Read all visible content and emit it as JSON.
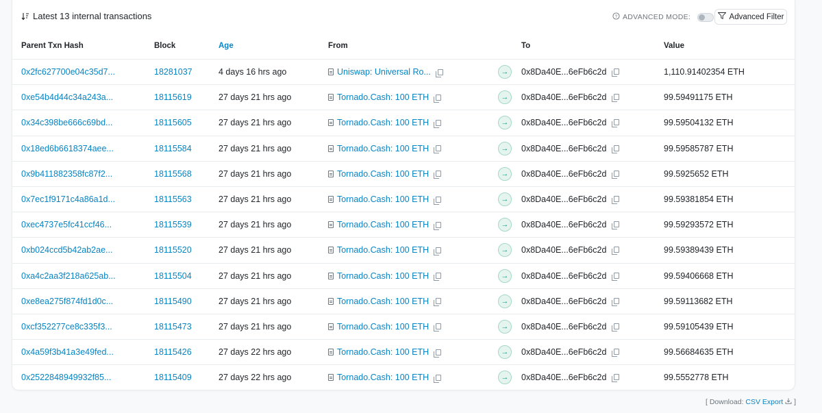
{
  "header": {
    "title": "Latest 13 internal transactions",
    "advanced_mode_label": "ADVANCED MODE:",
    "advanced_filter_label": "Advanced Filter"
  },
  "columns": {
    "parent_txn_hash": "Parent Txn Hash",
    "block": "Block",
    "age": "Age",
    "from": "From",
    "to": "To",
    "value": "Value"
  },
  "rows": [
    {
      "hash": "0x2fc627700e04c35d7...",
      "block": "18281037",
      "age": "4 days 16 hrs ago",
      "from": "Uniswap: Universal Ro...",
      "to": "0x8Da40E...6eFb6c2d",
      "value": "1,110.91402354 ETH"
    },
    {
      "hash": "0xe54b4d44c34a243a...",
      "block": "18115619",
      "age": "27 days 21 hrs ago",
      "from": "Tornado.Cash: 100 ETH",
      "to": "0x8Da40E...6eFb6c2d",
      "value": "99.59491175 ETH"
    },
    {
      "hash": "0x34c398be666c69bd...",
      "block": "18115605",
      "age": "27 days 21 hrs ago",
      "from": "Tornado.Cash: 100 ETH",
      "to": "0x8Da40E...6eFb6c2d",
      "value": "99.59504132 ETH"
    },
    {
      "hash": "0x18ed6b6618374aee...",
      "block": "18115584",
      "age": "27 days 21 hrs ago",
      "from": "Tornado.Cash: 100 ETH",
      "to": "0x8Da40E...6eFb6c2d",
      "value": "99.59585787 ETH"
    },
    {
      "hash": "0x9b411882358fc87f2...",
      "block": "18115568",
      "age": "27 days 21 hrs ago",
      "from": "Tornado.Cash: 100 ETH",
      "to": "0x8Da40E...6eFb6c2d",
      "value": "99.5925652 ETH"
    },
    {
      "hash": "0x7ec1f9171c4a86a1d...",
      "block": "18115563",
      "age": "27 days 21 hrs ago",
      "from": "Tornado.Cash: 100 ETH",
      "to": "0x8Da40E...6eFb6c2d",
      "value": "99.59381854 ETH"
    },
    {
      "hash": "0xec4737e5fc41ccf46...",
      "block": "18115539",
      "age": "27 days 21 hrs ago",
      "from": "Tornado.Cash: 100 ETH",
      "to": "0x8Da40E...6eFb6c2d",
      "value": "99.59293572 ETH"
    },
    {
      "hash": "0xb024ccd5b42ab2ae...",
      "block": "18115520",
      "age": "27 days 21 hrs ago",
      "from": "Tornado.Cash: 100 ETH",
      "to": "0x8Da40E...6eFb6c2d",
      "value": "99.59389439 ETH"
    },
    {
      "hash": "0xa4c2aa3f218a625ab...",
      "block": "18115504",
      "age": "27 days 21 hrs ago",
      "from": "Tornado.Cash: 100 ETH",
      "to": "0x8Da40E...6eFb6c2d",
      "value": "99.59406668 ETH"
    },
    {
      "hash": "0xe8ea275f874fd1d0c...",
      "block": "18115490",
      "age": "27 days 21 hrs ago",
      "from": "Tornado.Cash: 100 ETH",
      "to": "0x8Da40E...6eFb6c2d",
      "value": "99.59113682 ETH"
    },
    {
      "hash": "0xcf352277ce8c335f3...",
      "block": "18115473",
      "age": "27 days 21 hrs ago",
      "from": "Tornado.Cash: 100 ETH",
      "to": "0x8Da40E...6eFb6c2d",
      "value": "99.59105439 ETH"
    },
    {
      "hash": "0x4a59f3b41a3e49fed...",
      "block": "18115426",
      "age": "27 days 22 hrs ago",
      "from": "Tornado.Cash: 100 ETH",
      "to": "0x8Da40E...6eFb6c2d",
      "value": "99.56684635 ETH"
    },
    {
      "hash": "0x2522848949932f85...",
      "block": "18115409",
      "age": "27 days 22 hrs ago",
      "from": "Tornado.Cash: 100 ETH",
      "to": "0x8Da40E...6eFb6c2d",
      "value": "99.5552778 ETH"
    }
  ],
  "footer": {
    "download_prefix": "[ Download:",
    "csv_label": "CSV Export",
    "download_suffix": "]"
  },
  "colors": {
    "link": "#0784c3",
    "arrow_green": "#00a186"
  },
  "icons": {
    "sort": "sort-desc-icon",
    "info": "info-circle-icon",
    "filter": "filter-icon",
    "contract": "file-icon",
    "copy": "copy-icon",
    "arrow": "arrow-right-icon",
    "download": "download-icon"
  }
}
